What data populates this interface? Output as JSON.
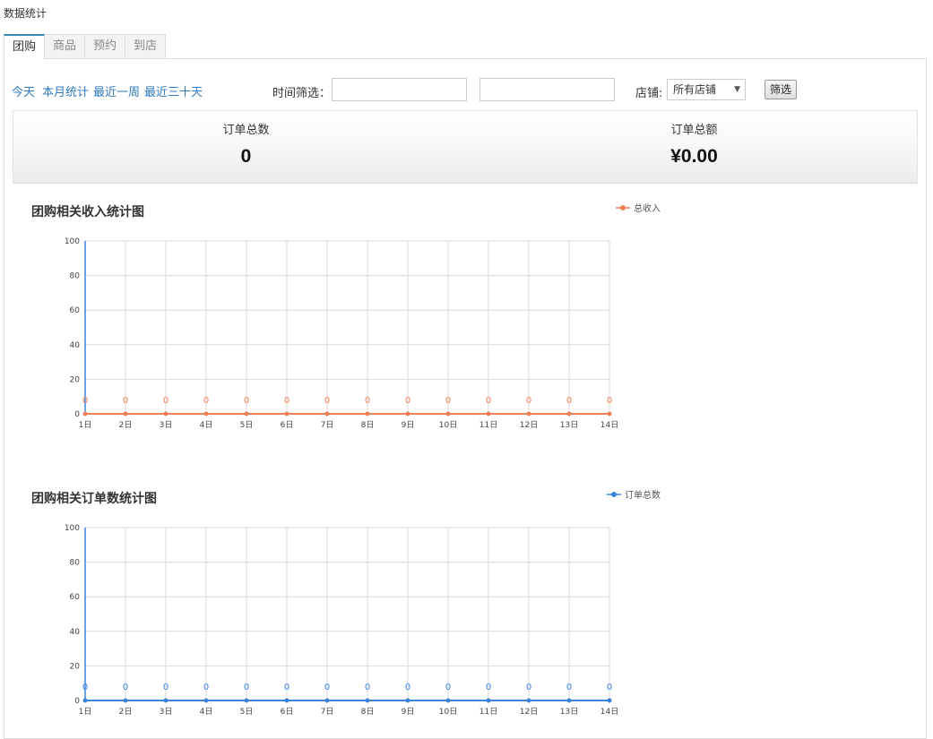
{
  "page": {
    "title": "数据统计"
  },
  "tabs": [
    {
      "label": "团购",
      "active": true
    },
    {
      "label": "商品",
      "active": false
    },
    {
      "label": "预约",
      "active": false
    },
    {
      "label": "到店",
      "active": false
    }
  ],
  "filters": {
    "quick": [
      "今天",
      "本月统计",
      "最近一周",
      "最近三十天"
    ],
    "time_label": "时间筛选：",
    "start_date": "",
    "end_date": "",
    "store_label": "店铺:",
    "store_selected": "所有店铺",
    "submit_label": "筛选"
  },
  "summary": {
    "orders_label": "订单总数",
    "orders_value": "0",
    "amount_label": "订单总额",
    "amount_value": "¥0.00"
  },
  "colors": {
    "income": "#f07f55",
    "orders": "#3a84dc",
    "link": "#2f7bbf"
  },
  "chart_data": [
    {
      "type": "line",
      "title": "团购相关收入统计图",
      "categories": [
        "1日",
        "2日",
        "3日",
        "4日",
        "5日",
        "6日",
        "7日",
        "8日",
        "9日",
        "10日",
        "11日",
        "12日",
        "13日",
        "14日"
      ],
      "series": [
        {
          "name": "总收入",
          "values": [
            0,
            0,
            0,
            0,
            0,
            0,
            0,
            0,
            0,
            0,
            0,
            0,
            0,
            0
          ]
        }
      ],
      "ylim": [
        0,
        100
      ],
      "yticks": [
        0,
        20,
        40,
        60,
        80,
        100
      ],
      "grid": true,
      "legend": "top-right",
      "data_labels": true
    },
    {
      "type": "line",
      "title": "团购相关订单数统计图",
      "categories": [
        "1日",
        "2日",
        "3日",
        "4日",
        "5日",
        "6日",
        "7日",
        "8日",
        "9日",
        "10日",
        "11日",
        "12日",
        "13日",
        "14日"
      ],
      "series": [
        {
          "name": "订单总数",
          "values": [
            0,
            0,
            0,
            0,
            0,
            0,
            0,
            0,
            0,
            0,
            0,
            0,
            0,
            0
          ]
        }
      ],
      "ylim": [
        0,
        100
      ],
      "yticks": [
        0,
        20,
        40,
        60,
        80,
        100
      ],
      "grid": true,
      "legend": "top-right",
      "data_labels": true
    }
  ]
}
